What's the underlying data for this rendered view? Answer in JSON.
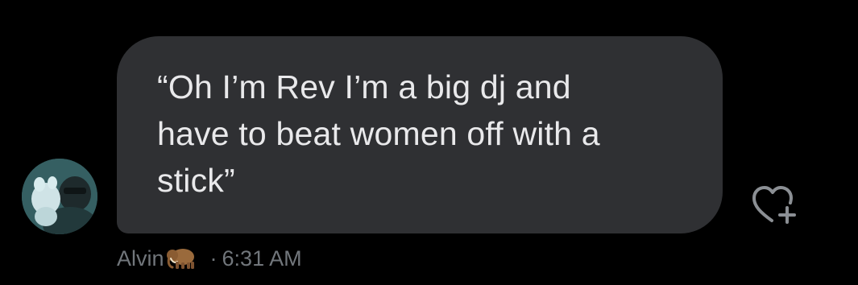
{
  "message": {
    "text": "“Oh I’m Rev I’m a big dj and\nhave to beat women off with a\nstick”",
    "sender_name": "Alvin",
    "sender_emoji": "mammoth",
    "separator": "·",
    "time": "6:31 AM"
  },
  "icons": {
    "avatar": "avatar-photo",
    "react": "heart-plus-icon",
    "emoji": "mammoth-emoji"
  },
  "colors": {
    "background": "#000000",
    "bubble": "#2f3033",
    "text": "#e9e9eb",
    "meta": "#71767b"
  }
}
